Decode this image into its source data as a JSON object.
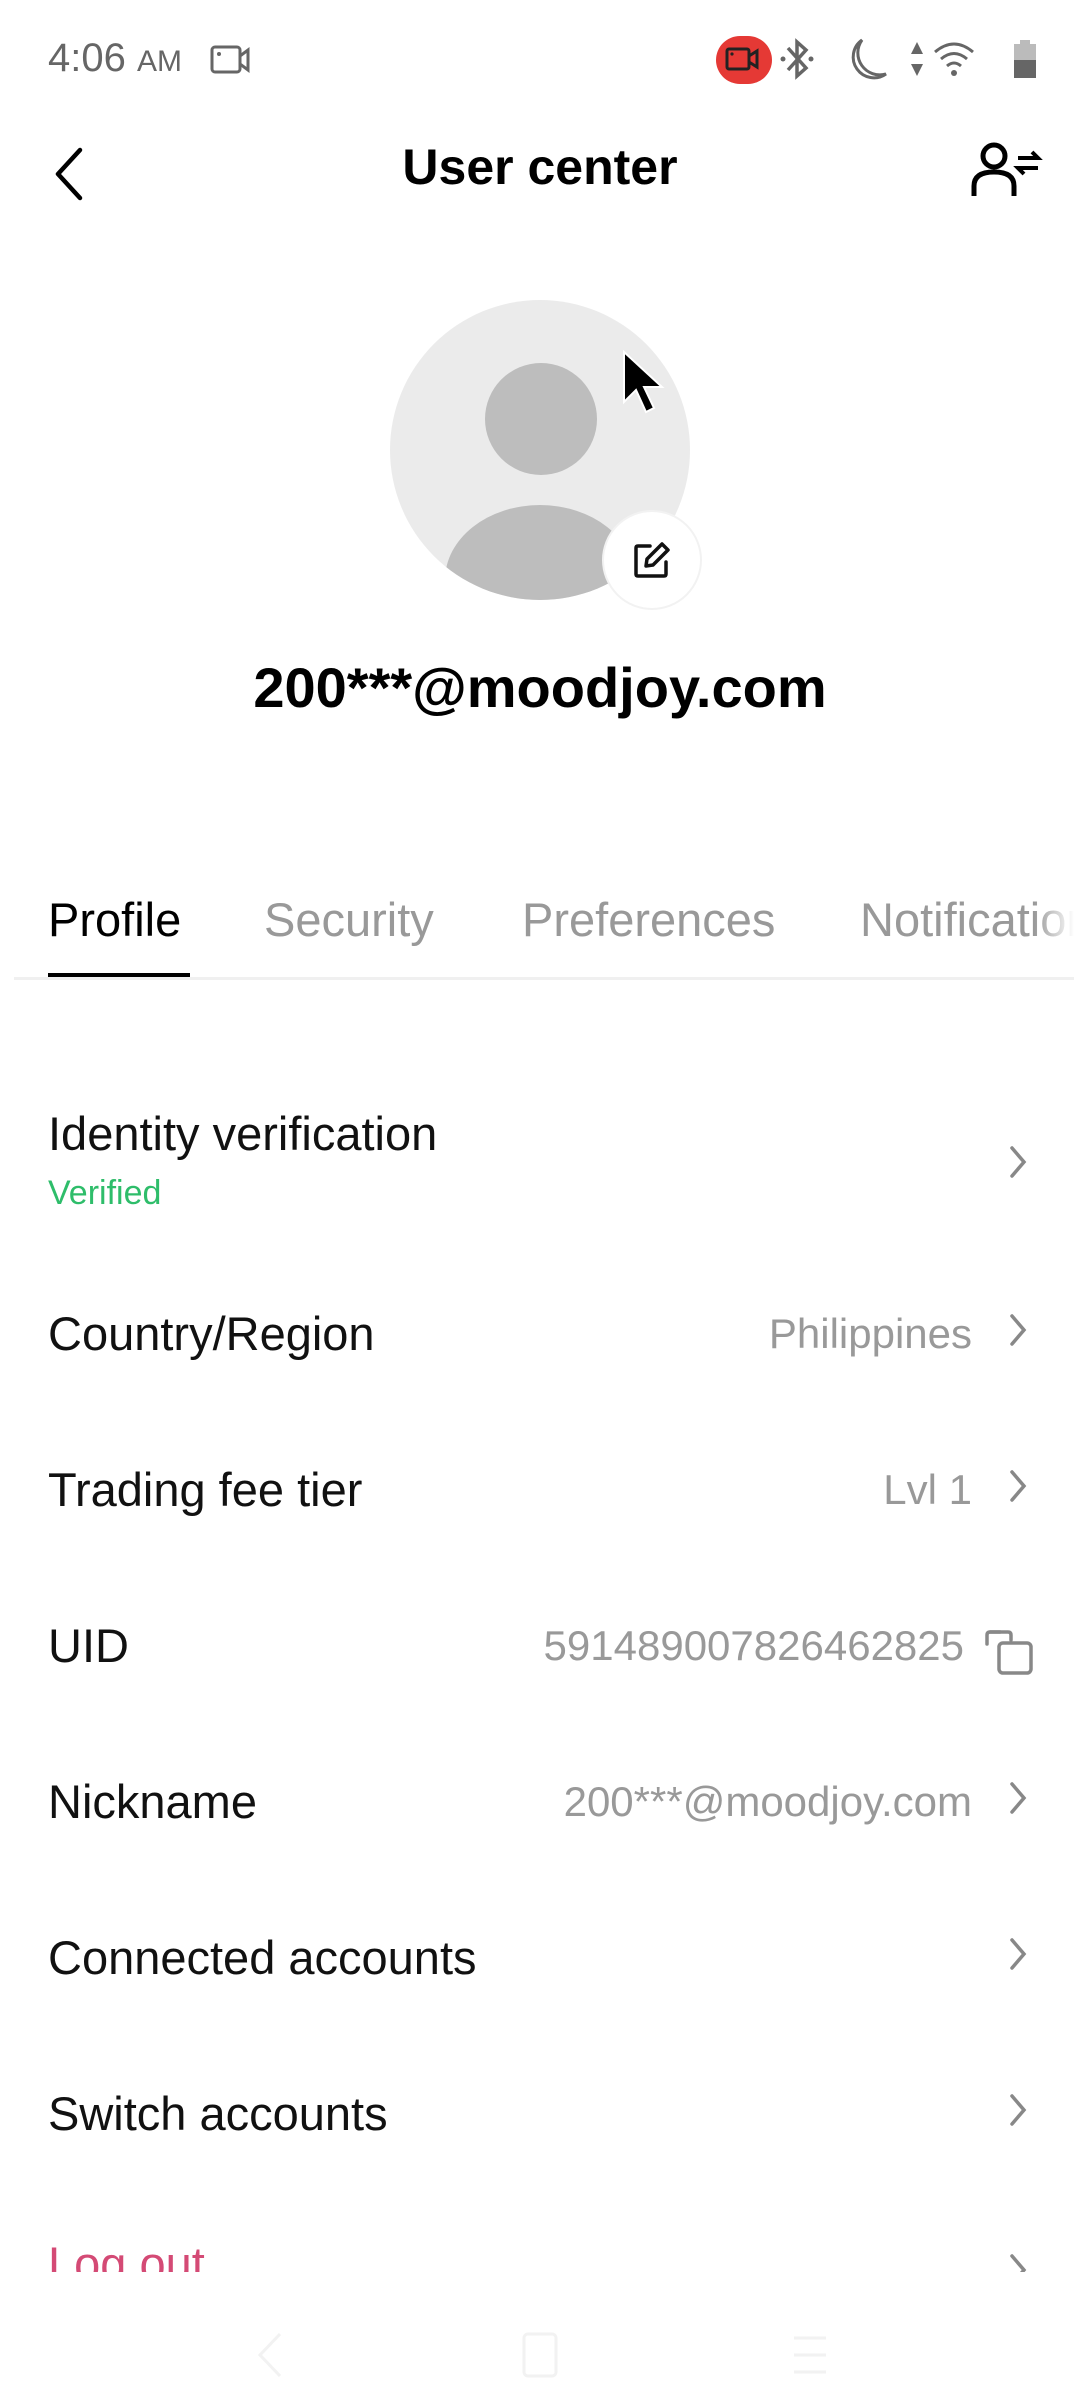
{
  "status_bar": {
    "time": "4:06",
    "ampm": "AM",
    "icons": [
      "screen-record-icon",
      "screen-record-active-icon",
      "bluetooth-icon",
      "do-not-disturb-moon-icon",
      "data-arrows-icon",
      "wifi-icon",
      "battery-icon"
    ],
    "record_color": "#e53935"
  },
  "header": {
    "title": "User center",
    "back_icon": "chevron-left-icon",
    "action_icon": "switch-account-icon"
  },
  "profile": {
    "email": "200***@moodjoy.com",
    "avatar_icon": "default-avatar-icon",
    "edit_icon": "edit-icon"
  },
  "tabs": [
    {
      "label": "Profile",
      "active": true
    },
    {
      "label": "Security",
      "active": false
    },
    {
      "label": "Preferences",
      "active": false
    },
    {
      "label": "Notifications",
      "active": false
    }
  ],
  "rows": {
    "identity": {
      "label": "Identity verification",
      "status": "Verified",
      "status_color": "#2ebd6a"
    },
    "country": {
      "label": "Country/Region",
      "value": "Philippines"
    },
    "fee_tier": {
      "label": "Trading fee tier",
      "value": "Lvl 1"
    },
    "uid": {
      "label": "UID",
      "value": "591489007826462825"
    },
    "nickname": {
      "label": "Nickname",
      "value": "200***@moodjoy.com"
    },
    "connected": {
      "label": "Connected accounts"
    },
    "switch": {
      "label": "Switch accounts"
    },
    "logout": {
      "label": "Log out",
      "color": "#d44a75"
    }
  }
}
